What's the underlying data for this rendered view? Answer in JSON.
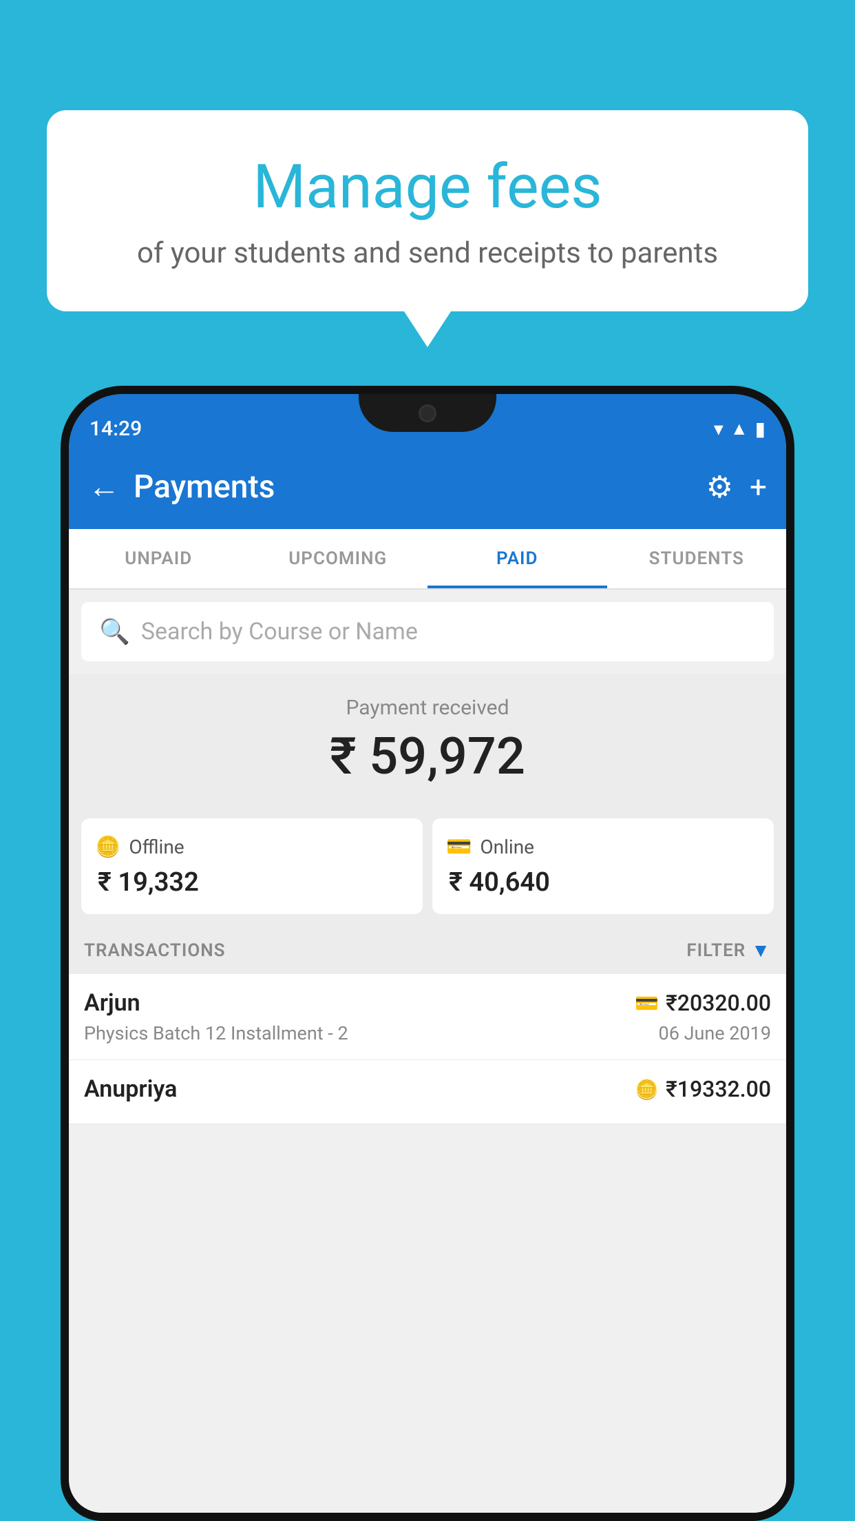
{
  "background_color": "#29b6d8",
  "speech_bubble": {
    "title": "Manage fees",
    "subtitle": "of your students and send receipts to parents"
  },
  "phone": {
    "status_bar": {
      "time": "14:29",
      "wifi_icon": "wifi",
      "signal_icon": "signal",
      "battery_icon": "battery"
    },
    "app_bar": {
      "back_label": "←",
      "title": "Payments",
      "settings_icon": "⚙",
      "plus_icon": "+"
    },
    "tabs": [
      {
        "id": "unpaid",
        "label": "UNPAID",
        "active": false
      },
      {
        "id": "upcoming",
        "label": "UPCOMING",
        "active": false
      },
      {
        "id": "paid",
        "label": "PAID",
        "active": true
      },
      {
        "id": "students",
        "label": "STUDENTS",
        "active": false
      }
    ],
    "search": {
      "placeholder": "Search by Course or Name"
    },
    "payment_received": {
      "label": "Payment received",
      "amount": "₹ 59,972"
    },
    "payment_cards": [
      {
        "id": "offline",
        "icon": "💳",
        "label": "Offline",
        "amount": "₹ 19,332"
      },
      {
        "id": "online",
        "icon": "💳",
        "label": "Online",
        "amount": "₹ 40,640"
      }
    ],
    "transactions_header": {
      "label": "TRANSACTIONS",
      "filter_label": "FILTER"
    },
    "transactions": [
      {
        "id": 1,
        "name": "Arjun",
        "course": "Physics Batch 12 Installment - 2",
        "amount": "₹20320.00",
        "date": "06 June 2019",
        "payment_type": "online"
      },
      {
        "id": 2,
        "name": "Anupriya",
        "course": "",
        "amount": "₹19332.00",
        "date": "",
        "payment_type": "offline"
      }
    ]
  }
}
